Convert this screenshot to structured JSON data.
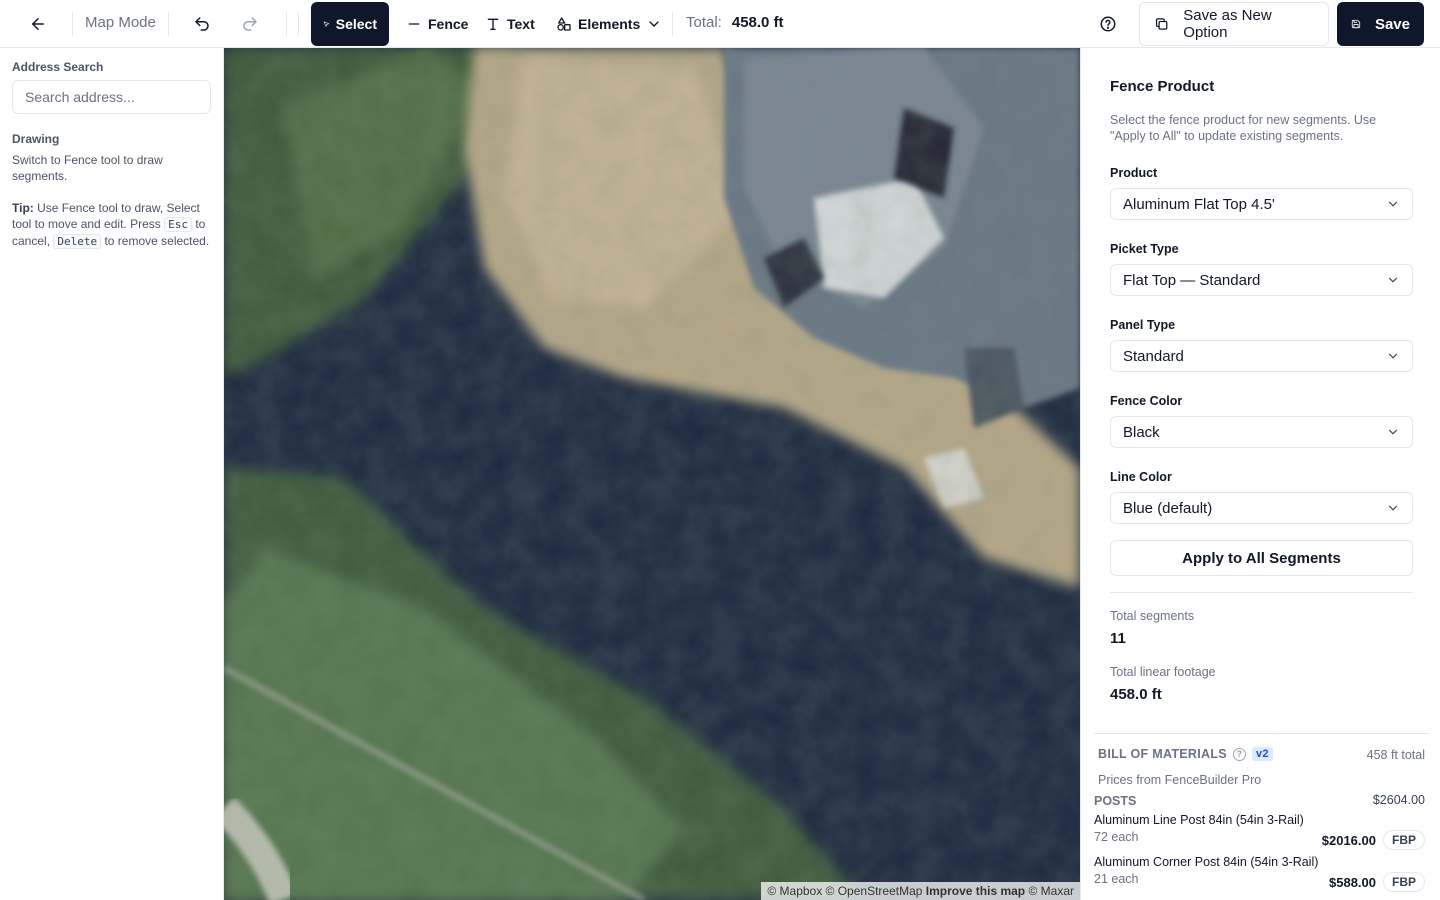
{
  "toolbar": {
    "back_icon": "arrow-left-icon",
    "mode_label": "Map Mode",
    "undo_icon": "undo-icon",
    "redo_icon": "redo-icon",
    "tools": [
      {
        "label": "Select",
        "icon": "cursor-icon",
        "active": true
      },
      {
        "label": "Fence",
        "icon": "minus-icon",
        "active": false
      },
      {
        "label": "Text",
        "icon": "text-icon",
        "active": false
      },
      {
        "label": "Elements",
        "icon": "shapes-icon",
        "active": false
      }
    ],
    "total_label": "Total:",
    "total_value": "458.0 ft",
    "help_icon": "help-circle-icon",
    "save_new_label": "Save as New Option",
    "save_label": "Save"
  },
  "left_panel": {
    "address_label": "Address Search",
    "address_placeholder": "Search address...",
    "drawing_label": "Drawing",
    "drawing_text": "Switch to Fence tool to draw segments.",
    "tip_bold": "Tip:",
    "tip_text_1": "Use Fence tool to draw, Select tool to move and edit. Press",
    "tip_key_1": "Esc",
    "tip_text_2": "to cancel,",
    "tip_key_2": "Delete",
    "tip_text_3": "to remove selected."
  },
  "map": {
    "attribution_1": "© Mapbox © OpenStreetMap",
    "attribution_link": "Improve this map",
    "attribution_2": "© Maxar"
  },
  "right_panel": {
    "title": "Fence Product",
    "description": "Select the fence product for new segments. Use \"Apply to All\" to update existing segments.",
    "fields": [
      {
        "label": "Product",
        "value": "Aluminum Flat Top 4.5'"
      },
      {
        "label": "Picket Type",
        "value": "Flat Top — Standard"
      },
      {
        "label": "Panel Type",
        "value": "Standard"
      },
      {
        "label": "Fence Color",
        "value": "Black"
      },
      {
        "label": "Line Color",
        "value": "Blue (default)"
      }
    ],
    "apply_label": "Apply to All Segments",
    "segments_label": "Total segments",
    "segments_value": "11",
    "footage_label": "Total linear footage",
    "footage_value": "458.0 ft"
  },
  "bom": {
    "title": "BILL OF MATERIALS",
    "version": "v2",
    "total": "458 ft total",
    "source": "Prices from FenceBuilder Pro",
    "category": "POSTS",
    "category_total": "$2604.00",
    "items": [
      {
        "name": "Aluminum Line Post 84in (54in 3-Rail)",
        "qty": "72 each",
        "price": "$2016.00",
        "tag": "FBP"
      },
      {
        "name": "Aluminum Corner Post 84in (54in 3-Rail)",
        "qty": "21 each",
        "price": "$588.00",
        "tag": "FBP"
      }
    ]
  }
}
